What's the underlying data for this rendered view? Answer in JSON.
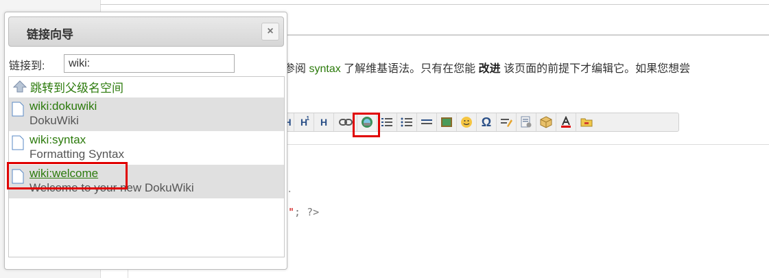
{
  "dialog": {
    "title": "链接向导",
    "close_icon": "×",
    "link_label": "链接到:",
    "link_value": "wiki:",
    "up_item": "跳转到父级名空间",
    "results": [
      {
        "id": "wiki:dokuwiki",
        "title": "DokuWiki"
      },
      {
        "id": "wiki:syntax",
        "title": "Formatting Syntax"
      },
      {
        "id": "wiki:welcome",
        "title": "Welcome to your new DokuWiki"
      }
    ]
  },
  "page": {
    "intro_pre": "请参阅",
    "intro_link": "syntax",
    "intro_mid": "了解维基语法。只有在您能",
    "intro_bold": "改进",
    "intro_post": "该页面的前提下才编辑它。如果您想尝"
  },
  "toolbar": {
    "h3": "H",
    "h3_sub": "1",
    "h4": "H",
    "h4_sub": "1",
    "h5": "H"
  },
  "code": {
    "frag1": "·",
    "frag2_quote": "\"",
    "frag2_rest": "; ?>"
  },
  "colors": {
    "link_green": "#2b7a0b",
    "highlight_red": "#e00000",
    "alt_row": "#e0e0e0"
  }
}
